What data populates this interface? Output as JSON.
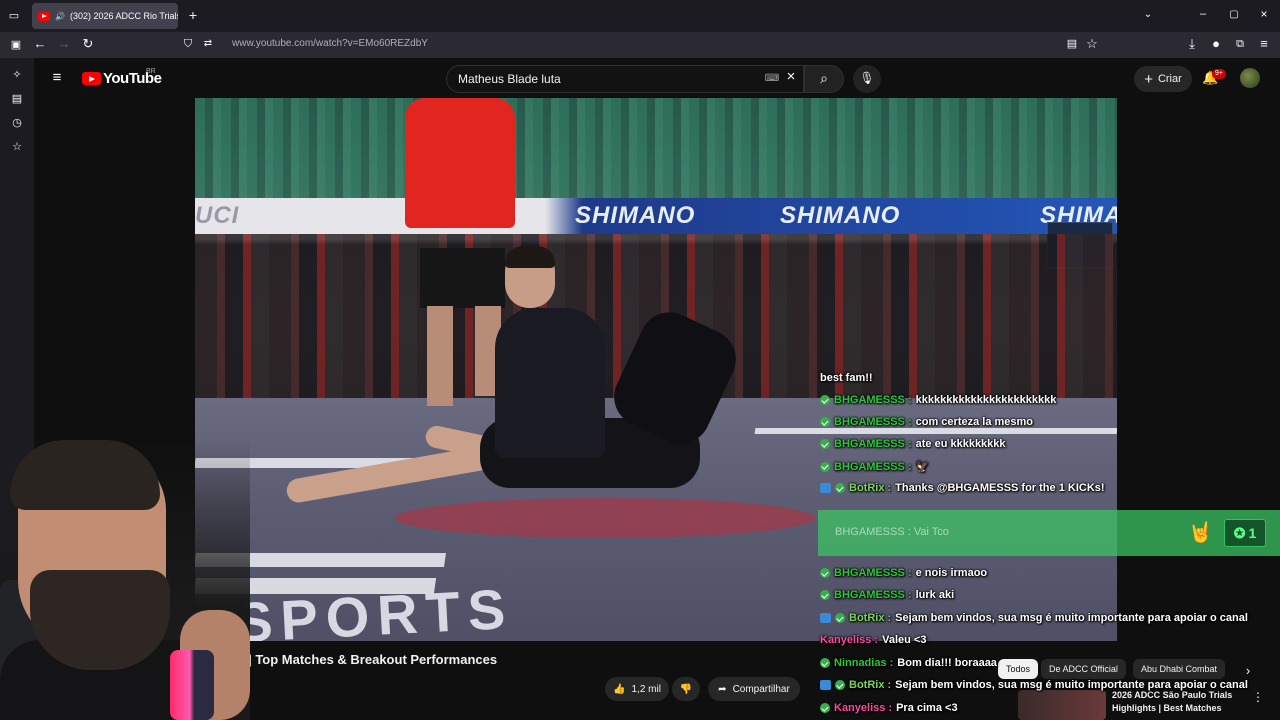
{
  "browser": {
    "tab_title": "(302) 2026 ADCC Rio Trials",
    "url": "www.youtube.com/watch?v=EMo60REZdbY"
  },
  "youtube": {
    "logo_text": "YouTube",
    "country_code": "BR",
    "search_query": "Matheus Blade luta",
    "create_label": "Criar",
    "notifications_count": "9+"
  },
  "video": {
    "banner_texts": [
      "SHIMANO",
      "SHIMANO",
      "SHIMA"
    ],
    "watermark_left": "UCI",
    "mat_text": "SPORTS"
  },
  "chat": {
    "messages": [
      {
        "user": "",
        "text": "best fam!!",
        "badge": "none",
        "color": "white"
      },
      {
        "user": "BHGAMESSS",
        "text": "kkkkkkkkkkkkkkkkkkkkkkk",
        "badge": "check",
        "color": "green"
      },
      {
        "user": "BHGAMESSS",
        "text": "com certeza la mesmo",
        "badge": "check",
        "color": "green"
      },
      {
        "user": "BHGAMESSS",
        "text": "ate eu kkkkkkkkk",
        "badge": "check",
        "color": "green"
      },
      {
        "user": "BHGAMESSS",
        "text": "🦅",
        "badge": "check",
        "color": "green"
      },
      {
        "user": "BotRix",
        "text": "Thanks @BHGAMESSS for the 1 KICKs!",
        "badge": "bot",
        "color": "lime"
      },
      {
        "user": "BHGAMESSS",
        "text": "e nois irmaoo",
        "badge": "check",
        "color": "green"
      },
      {
        "user": "BHGAMESSS",
        "text": "lurk aki",
        "badge": "check",
        "color": "green"
      },
      {
        "user": "BotRix",
        "text": "Sejam bem vindos, sua msg é muito importante para apoiar o canal",
        "badge": "bot",
        "color": "lime"
      },
      {
        "user": "Kanyeliss",
        "text": "Valeu <3",
        "badge": "none",
        "color": "pink"
      },
      {
        "user": "Ninnadias",
        "text": "Bom dia!!! boraaaa",
        "badge": "check",
        "color": "green"
      },
      {
        "user": "BotRix",
        "text": "Sejam bem vindos, sua msg é muito importante para apoiar o canal",
        "badge": "bot",
        "color": "lime"
      },
      {
        "user": "Kanyeliss",
        "text": "Pra cima <3",
        "badge": "check",
        "color": "pink"
      }
    ],
    "highlight": {
      "text": "BHGAMESSS : Vai Tco",
      "kick_count": "1"
    }
  },
  "below_video": {
    "title": "es | Top Matches & Breakout Performances",
    "likes": "1,2 mil",
    "share_label": "Compartilhar",
    "chips": [
      "Todos",
      "De ADCC Official",
      "Abu Dhabi Combat"
    ],
    "recommended_title_line1": "2026 ADCC São Paulo Trials",
    "recommended_title_line2": "Highlights | Best Matches"
  },
  "colors": {
    "accent_red": "#ff0000",
    "chat_green": "#2ec63a",
    "chat_pink": "#ff4aa0",
    "kick_green": "#3cc864"
  }
}
